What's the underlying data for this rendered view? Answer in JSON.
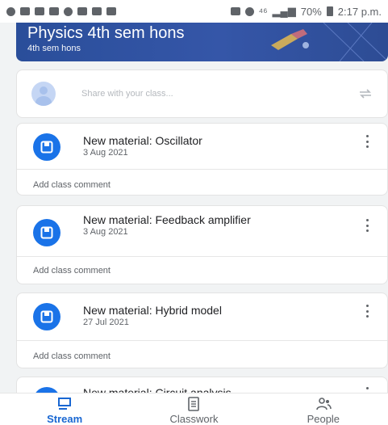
{
  "status_bar": {
    "network": "⁴⁶",
    "battery": "70%",
    "time": "2:17 p.m."
  },
  "banner": {
    "title": "Physics 4th sem hons",
    "subtitle": "4th sem hons"
  },
  "share": {
    "placeholder": "Share with your class..."
  },
  "stream": [
    {
      "title": "New material: Oscillator",
      "date": "3 Aug 2021",
      "comment": "Add class comment"
    },
    {
      "title": "New material: Feedback amplifier",
      "date": "3 Aug 2021",
      "comment": "Add class comment"
    },
    {
      "title": "New material: Hybrid model",
      "date": "27 Jul 2021",
      "comment": "Add class comment"
    },
    {
      "title": "New material: Circuit analysis",
      "date": "",
      "comment": ""
    }
  ],
  "nav": [
    {
      "label": "Stream",
      "icon": "stream-icon",
      "active": true
    },
    {
      "label": "Classwork",
      "icon": "classwork-icon",
      "active": false
    },
    {
      "label": "People",
      "icon": "people-icon",
      "active": false
    }
  ],
  "colors": {
    "accent": "#1a73e8",
    "banner": "#3556a8",
    "active_nav": "#1967d2"
  }
}
